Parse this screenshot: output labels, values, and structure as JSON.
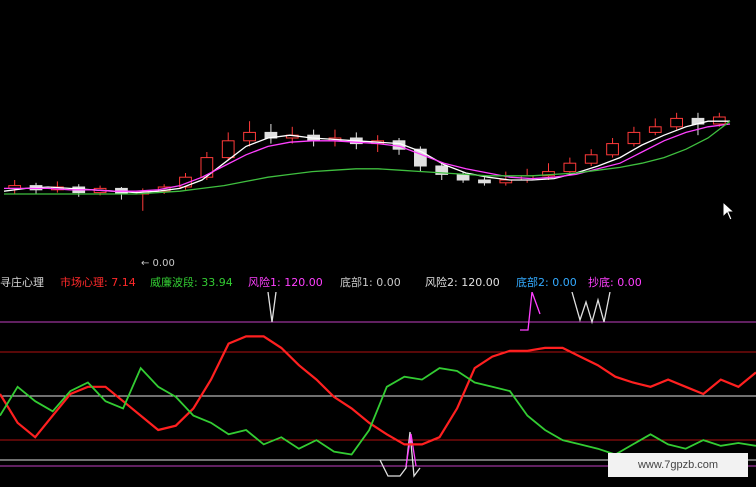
{
  "colors": {
    "background": "#000000",
    "kline": "#d0d0d0",
    "up_candle": "#ff3a3a",
    "down_candle": "#e0e0e0",
    "ma_white": "#ffffff",
    "ma_magenta": "#ff40ff",
    "ma_green": "#3fbf3f",
    "market_psych_line": "#ff2020",
    "williams_line": "#33cc33",
    "risk_line": "#ff40ff",
    "reference_line_red": "#b01010",
    "reference_line_white": "#e0e0e0",
    "reference_line_magenta": "#c040c0"
  },
  "price_panel": {
    "low_marker": "← 0.00"
  },
  "indicator_header": {
    "title": "寻庄心理",
    "items": [
      {
        "label": "市场心理:",
        "value": "7.14",
        "color": "#ff2a2a"
      },
      {
        "label": "威廉波段:",
        "value": "33.94",
        "color": "#33cc33"
      },
      {
        "label": "风险1:",
        "value": "120.00",
        "color": "#ff40ff"
      },
      {
        "label": "底部1:",
        "value": "0.00",
        "color": "#c8c8c8"
      },
      {
        "label": "风险2:",
        "value": "120.00",
        "color": "#e0e0e0"
      },
      {
        "label": "底部2:",
        "value": "0.00",
        "color": "#33aaff"
      },
      {
        "label": "抄底:",
        "value": "0.00",
        "color": "#ff40ff"
      }
    ]
  },
  "watermark": "www.7gpzb.com",
  "cursor": "arrow-cursor-icon",
  "chart_data": [
    {
      "type": "line",
      "ma_series": [
        {
          "values": [
            42,
            44,
            45,
            44,
            43,
            42,
            41,
            42,
            44,
            50,
            62,
            74,
            80,
            82,
            80,
            79,
            78,
            77,
            76,
            70,
            61,
            55,
            52,
            50,
            50,
            51,
            55,
            60,
            66,
            75,
            82,
            88,
            92,
            92
          ]
        },
        {
          "values": [
            44,
            44,
            44,
            43,
            43,
            42,
            42,
            43,
            46,
            52,
            60,
            68,
            74,
            77,
            78,
            78,
            77,
            76,
            74,
            68,
            62,
            58,
            55,
            52,
            51,
            52,
            54,
            58,
            62,
            70,
            78,
            84,
            88,
            90
          ]
        },
        {
          "values": [
            40,
            40,
            40,
            40,
            40,
            40,
            40,
            41,
            42,
            44,
            46,
            49,
            52,
            54,
            56,
            57,
            58,
            58,
            57,
            56,
            55,
            54,
            53,
            53,
            53,
            54,
            55,
            57,
            59,
            62,
            66,
            72,
            80,
            92
          ]
        }
      ],
      "candles": [
        {
          "o": 44,
          "c": 46,
          "h": 50,
          "l": 40
        },
        {
          "o": 46,
          "c": 43,
          "h": 48,
          "l": 40
        },
        {
          "o": 43,
          "c": 45,
          "h": 49,
          "l": 41
        },
        {
          "o": 45,
          "c": 41,
          "h": 47,
          "l": 38
        },
        {
          "o": 41,
          "c": 44,
          "h": 46,
          "l": 39
        },
        {
          "o": 44,
          "c": 40,
          "h": 45,
          "l": 36
        },
        {
          "o": 40,
          "c": 42,
          "h": 44,
          "l": 28
        },
        {
          "o": 42,
          "c": 45,
          "h": 47,
          "l": 40
        },
        {
          "o": 45,
          "c": 52,
          "h": 55,
          "l": 43
        },
        {
          "o": 52,
          "c": 66,
          "h": 70,
          "l": 50
        },
        {
          "o": 66,
          "c": 78,
          "h": 84,
          "l": 64
        },
        {
          "o": 78,
          "c": 84,
          "h": 92,
          "l": 74
        },
        {
          "o": 84,
          "c": 80,
          "h": 90,
          "l": 76
        },
        {
          "o": 80,
          "c": 82,
          "h": 88,
          "l": 76
        },
        {
          "o": 82,
          "c": 78,
          "h": 86,
          "l": 74
        },
        {
          "o": 78,
          "c": 80,
          "h": 86,
          "l": 74
        },
        {
          "o": 80,
          "c": 76,
          "h": 84,
          "l": 72
        },
        {
          "o": 76,
          "c": 78,
          "h": 82,
          "l": 70
        },
        {
          "o": 78,
          "c": 72,
          "h": 80,
          "l": 68
        },
        {
          "o": 72,
          "c": 60,
          "h": 74,
          "l": 56
        },
        {
          "o": 60,
          "c": 54,
          "h": 62,
          "l": 50
        },
        {
          "o": 54,
          "c": 50,
          "h": 56,
          "l": 48
        },
        {
          "o": 50,
          "c": 48,
          "h": 52,
          "l": 46
        },
        {
          "o": 48,
          "c": 50,
          "h": 56,
          "l": 46
        },
        {
          "o": 50,
          "c": 53,
          "h": 58,
          "l": 48
        },
        {
          "o": 53,
          "c": 56,
          "h": 62,
          "l": 50
        },
        {
          "o": 56,
          "c": 62,
          "h": 66,
          "l": 54
        },
        {
          "o": 62,
          "c": 68,
          "h": 72,
          "l": 60
        },
        {
          "o": 68,
          "c": 76,
          "h": 80,
          "l": 66
        },
        {
          "o": 76,
          "c": 84,
          "h": 88,
          "l": 74
        },
        {
          "o": 84,
          "c": 88,
          "h": 94,
          "l": 82
        },
        {
          "o": 88,
          "c": 94,
          "h": 98,
          "l": 86
        },
        {
          "o": 94,
          "c": 90,
          "h": 98,
          "l": 82
        },
        {
          "o": 90,
          "c": 95,
          "h": 98,
          "l": 88
        }
      ],
      "ylim": [
        0,
        100
      ]
    },
    {
      "type": "line",
      "series": [
        {
          "values": [
            50,
            30,
            20,
            35,
            50,
            55,
            55,
            45,
            35,
            25,
            28,
            40,
            60,
            85,
            90,
            90,
            82,
            70,
            60,
            48,
            40,
            30,
            22,
            15,
            15,
            20,
            40,
            68,
            76,
            80,
            80,
            82,
            82,
            76,
            70,
            62,
            58,
            55,
            60,
            55,
            50,
            60,
            55,
            65
          ]
        },
        {
          "values": [
            35,
            55,
            45,
            38,
            52,
            58,
            45,
            40,
            68,
            55,
            48,
            35,
            30,
            22,
            25,
            15,
            20,
            12,
            18,
            10,
            8,
            25,
            55,
            62,
            60,
            68,
            66,
            58,
            55,
            52,
            35,
            25,
            18,
            15,
            12,
            8,
            15,
            22,
            15,
            12,
            18,
            14,
            16,
            14
          ]
        }
      ],
      "ylim": [
        0,
        100
      ]
    }
  ]
}
